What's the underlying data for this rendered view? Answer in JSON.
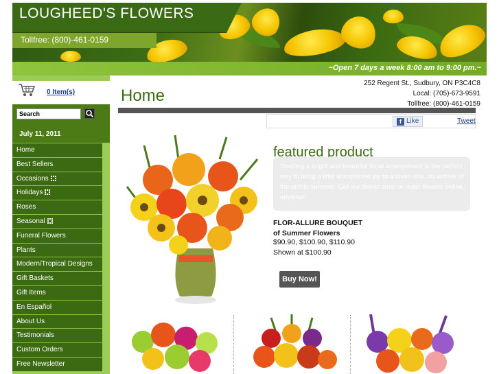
{
  "header": {
    "title": "LOUGHEED'S FLOWERS",
    "tollfree": "Tollfree: (800)-461-0159",
    "hours": "~Open 7 days a week 8:00 am to 9:00 pm.~"
  },
  "sidebar": {
    "cart_label": "0 Item(s)",
    "search_value": "Search",
    "date": "July 11, 2011",
    "items": [
      {
        "label": "Home",
        "submenu": false
      },
      {
        "label": "Best Sellers",
        "submenu": false
      },
      {
        "label": "Occasions",
        "submenu": true
      },
      {
        "label": "Holidays",
        "submenu": true
      },
      {
        "label": "Roses",
        "submenu": false
      },
      {
        "label": "Seasonal",
        "submenu": true
      },
      {
        "label": "Funeral Flowers",
        "submenu": false
      },
      {
        "label": "Plants",
        "submenu": false
      },
      {
        "label": "Modern/Tropical Designs",
        "submenu": false
      },
      {
        "label": "Gift Baskets",
        "submenu": false
      },
      {
        "label": "Gift Items",
        "submenu": false
      },
      {
        "label": "En Español",
        "submenu": false
      },
      {
        "label": "About Us",
        "submenu": false
      },
      {
        "label": "Testimonials",
        "submenu": false
      },
      {
        "label": "Custom Orders",
        "submenu": false
      },
      {
        "label": "Free Newsletter",
        "submenu": false
      }
    ]
  },
  "main": {
    "page_title": "Home",
    "address": {
      "street": "252 Regent St., Sudbury, ON P3C4C8",
      "local": "Local: (705)-673-9591",
      "tollfree": "Tollfree: (800)-461-0159"
    },
    "social": {
      "like_label": "Like",
      "tweet_label": "Tweet"
    },
    "featured": {
      "heading": "featured product",
      "description": "Sending a bright and beautiful floral arrangement is the perfect way to bring a little unexpected joy to a loved one, co-worker or friend this summer. Call our flower shop or order flowers online, anytime!",
      "name_line1": "FLOR-ALLURE BOUQUET",
      "name_line2": "of Summer Flowers",
      "prices": "$90.90, $100.90, $110.90",
      "shown_at": "Shown at $100.90",
      "buy_label": "Buy Now!"
    }
  },
  "colors": {
    "brand_green": "#3d6b12",
    "nav_bg": "#3c6a12",
    "sidebar_light": "#9ccc55",
    "hours_bar": "#7ea52c",
    "link_blue": "#1a3a8a"
  },
  "icons": [
    "cart-icon",
    "search-icon",
    "facebook-icon",
    "submenu-plus-icon"
  ]
}
